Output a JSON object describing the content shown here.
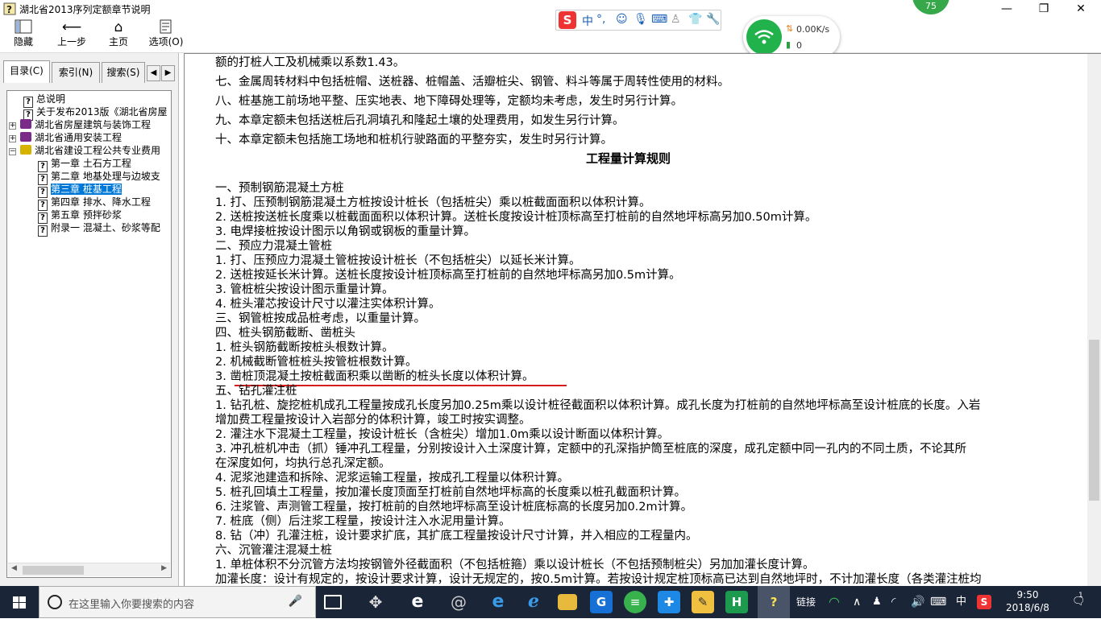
{
  "window": {
    "title": "湖北省2013序列定额章节说明",
    "minimize": "—",
    "maximize": "❐",
    "close": "✕"
  },
  "toolbar": {
    "hide": "隐藏",
    "back": "上一步",
    "home": "主页",
    "options": "选项(O)"
  },
  "ime": {
    "mode": "中",
    "punct": "°,"
  },
  "network": {
    "speed": "0.00K/s",
    "count": "0",
    "badge": "75"
  },
  "sidebar": {
    "tabs": [
      "目录(C)",
      "索引(N)",
      "搜索(S)"
    ],
    "tree": [
      {
        "label": "总说明",
        "type": "doc",
        "indent": 1
      },
      {
        "label": "关于发布2013版《湖北省房屋",
        "type": "doc",
        "indent": 1
      },
      {
        "label": "湖北省房屋建筑与装饰工程",
        "type": "book",
        "indent": 0,
        "toggle": "+"
      },
      {
        "label": "湖北省通用安装工程",
        "type": "book",
        "indent": 0,
        "toggle": "+"
      },
      {
        "label": "湖北省建设工程公共专业费用",
        "type": "book-open",
        "indent": 0,
        "toggle": "−"
      },
      {
        "label": "第一章 土石方工程",
        "type": "doc",
        "indent": 2
      },
      {
        "label": "第二章 地基处理与边坡支",
        "type": "doc",
        "indent": 2
      },
      {
        "label": "第三章 桩基工程",
        "type": "doc",
        "indent": 2,
        "selected": true
      },
      {
        "label": "第四章 排水、降水工程",
        "type": "doc",
        "indent": 2
      },
      {
        "label": "第五章 预拌砂浆",
        "type": "doc",
        "indent": 2
      },
      {
        "label": "附录一 混凝土、砂浆等配",
        "type": "doc",
        "indent": 2
      }
    ]
  },
  "content": {
    "lines": [
      "额的打桩人工及机械乘以系数1.43。",
      "七、金属周转材料中包括桩帽、送桩器、桩帽盖、活瓣桩尖、钢管、料斗等属于周转性使用的材料。",
      "八、桩基施工前场地平整、压实地表、地下障碍处理等，定额均未考虑，发生时另行计算。",
      "九、本章定额未包括送桩后孔洞填孔和隆起土壤的处理费用，如发生另行计算。",
      "十、本章定额未包括施工场地和桩机行驶路面的平整夯实，发生时另行计算。",
      "一、预制钢筋混凝土方桩",
      "1. 打、压预制钢筋混凝土方桩按设计桩长（包括桩尖）乘以桩截面面积以体积计算。",
      "2. 送桩按送桩长度乘以桩截面面积以体积计算。送桩长度按设计桩顶标高至打桩前的自然地坪标高另加0.50m计算。",
      "3. 电焊接桩按设计图示以角钢或钢板的重量计算。",
      "二、预应力混凝土管桩",
      "1. 打、压预应力混凝土管桩按设计桩长（不包括桩尖）以延长米计算。",
      "2. 送桩按延长米计算。送桩长度按设计桩顶标高至打桩前的自然地坪标高另加0.5m计算。",
      "3. 管桩桩尖按设计图示重量计算。",
      "4. 桩头灌芯按设计尺寸以灌注实体积计算。",
      "三、钢管桩按成品桩考虑，以重量计算。",
      "四、桩头钢筋截断、凿桩头",
      "1. 桩头钢筋截断按桩头根数计算。",
      "2. 机械截断管桩桩头按管桩根数计算。",
      "3. 凿桩顶混凝土按桩截面积乘以凿断的桩头长度以体积计算。",
      "五、钻孔灌注桩",
      "1. 钻孔桩、旋挖桩机成孔工程量按成孔长度另加0.25m乘以设计桩径截面积以体积计算。成孔长度为打桩前的自然地坪标高至设计桩底的长度。入岩",
      "增加费工程量按设计入岩部分的体积计算，竣工时按实调整。",
      "2. 灌注水下混凝土工程量，按设计桩长（含桩尖）增加1.0m乘以设计断面以体积计算。",
      "3. 冲孔桩机冲击（抓）锤冲孔工程量，分别按设计入土深度计算，定额中的孔深指护筒至桩底的深度，成孔定额中同一孔内的不同土质，不论其所",
      "在深度如何，均执行总孔深定额。",
      "4. 泥浆池建造和拆除、泥浆运输工程量，按成孔工程量以体积计算。",
      "5. 桩孔回填土工程量，按加灌长度顶面至打桩前自然地坪标高的长度乘以桩孔截面积计算。",
      "6. 注浆管、声测管工程量，按打桩前的自然地坪标高至设计桩底标高的长度另加0.2m计算。",
      "7. 桩底（侧）后注浆工程量，按设计注入水泥用量计算。",
      "8. 钻（冲）孔灌注桩，设计要求扩底，其扩底工程量按设计尺寸计算，并入相应的工程量内。",
      "六、沉管灌注混凝土桩",
      "1. 单桩体积不分沉管方法均按钢管外径截面积（不包括桩箍）乘以设计桩长（不包括预制桩尖）另加加灌长度计算。",
      "加灌长度：设计有规定的，按设计要求计算，设计无规定的，按0.5m计算。若按设计规定桩顶标高已达到自然地坪时，不计加灌长度（各类灌注桩均"
    ],
    "heading": "工程量计算规则"
  },
  "taskbar": {
    "search_placeholder": "在这里输入你要搜索的内容",
    "link_label": "链接",
    "ime_lang": "中",
    "time": "9:50",
    "date": "2018/6/8",
    "notif_count": "1"
  }
}
